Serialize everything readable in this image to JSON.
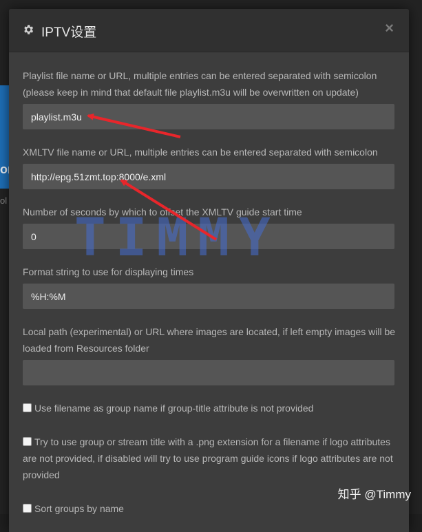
{
  "dialog": {
    "title": "IPTV设置",
    "close_symbol": "×"
  },
  "background": {
    "tile_text": "or",
    "side_text": "ol"
  },
  "fields": {
    "playlist": {
      "label": "Playlist file name or URL, multiple entries can be entered separated with semicolon (please keep in mind that default file playlist.m3u will be overwritten on update)",
      "value": "playlist.m3u"
    },
    "xmltv": {
      "label": "XMLTV file name or URL, multiple entries can be entered separated with semicolon",
      "value": "http://epg.51zmt.top:8000/e.xml"
    },
    "offset": {
      "label": "Number of seconds by which to offset the XMLTV guide start time",
      "value": "0"
    },
    "time_format": {
      "label": "Format string to use for displaying times",
      "value": "%H:%M"
    },
    "images_path": {
      "label": "Local path (experimental) or URL where images are located, if left empty images will be loaded from Resources folder",
      "value": ""
    }
  },
  "checkboxes": {
    "filename_group": {
      "label": "Use filename as group name if group-title attribute is not provided",
      "checked": false
    },
    "png_title": {
      "label": "Try to use group or stream title with a .png extension for a filename if logo attributes are not provided, if disabled will try to use program guide icons if logo attributes are not provided",
      "checked": false
    },
    "sort_groups": {
      "label": "Sort groups by name",
      "checked": false
    }
  },
  "watermark": {
    "text": "TIMMY",
    "color": "#466ed2"
  },
  "credit": {
    "text": "知乎 @Timmy"
  },
  "colors": {
    "annotation_arrow": "#e8262b",
    "modal_bg": "#3d3d3d",
    "input_bg": "#555555"
  }
}
